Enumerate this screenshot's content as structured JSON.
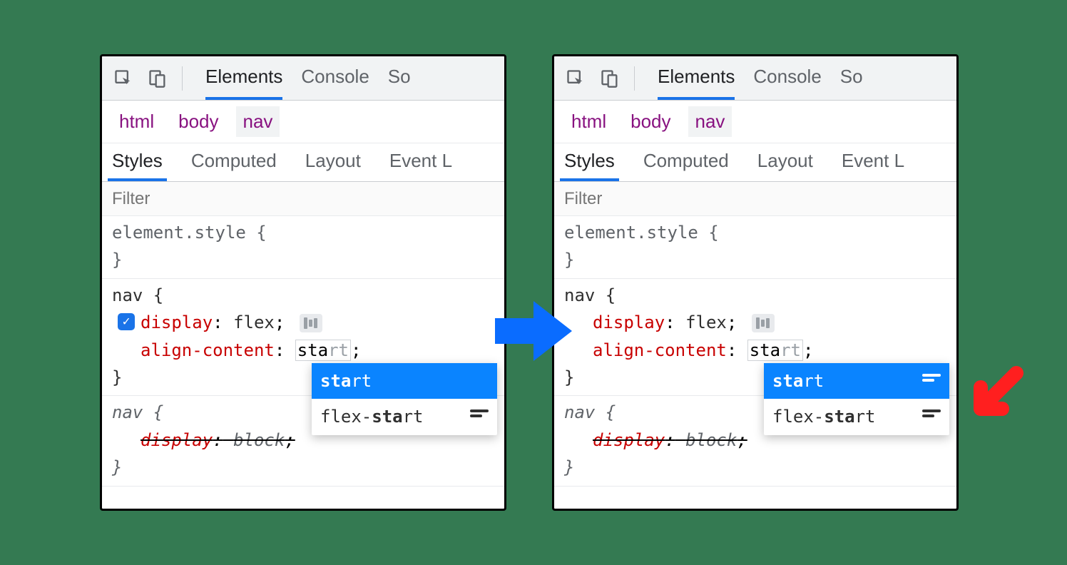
{
  "toolbar": {
    "tabs": [
      "Elements",
      "Console",
      "So"
    ]
  },
  "crumbs": [
    "html",
    "body",
    "nav"
  ],
  "subtabs": [
    "Styles",
    "Computed",
    "Layout",
    "Event L"
  ],
  "filter": {
    "placeholder": "Filter"
  },
  "rule1": {
    "selector": "element.style {",
    "close": "}"
  },
  "rule2": {
    "selector": "nav {",
    "decl1_prop": "display",
    "decl1_val": "flex",
    "decl2_prop": "align-content",
    "decl2_val_typed": "sta",
    "decl2_val_hint": "rt",
    "close": "}"
  },
  "rule3": {
    "selector": "nav {",
    "decl_prop": "display",
    "decl_val": "block",
    "close": "}"
  },
  "ac1": {
    "items": [
      {
        "pre": "sta",
        "post": "rt",
        "icon": false
      },
      {
        "pre": "flex-",
        "mid": "sta",
        "post": "rt",
        "icon": true
      }
    ]
  },
  "ac2": {
    "items": [
      {
        "pre": "sta",
        "post": "rt",
        "icon": true
      },
      {
        "pre": "flex-",
        "mid": "sta",
        "post": "rt",
        "icon": true
      }
    ]
  },
  "punct": {
    "colon": ":",
    "semi": ";"
  }
}
